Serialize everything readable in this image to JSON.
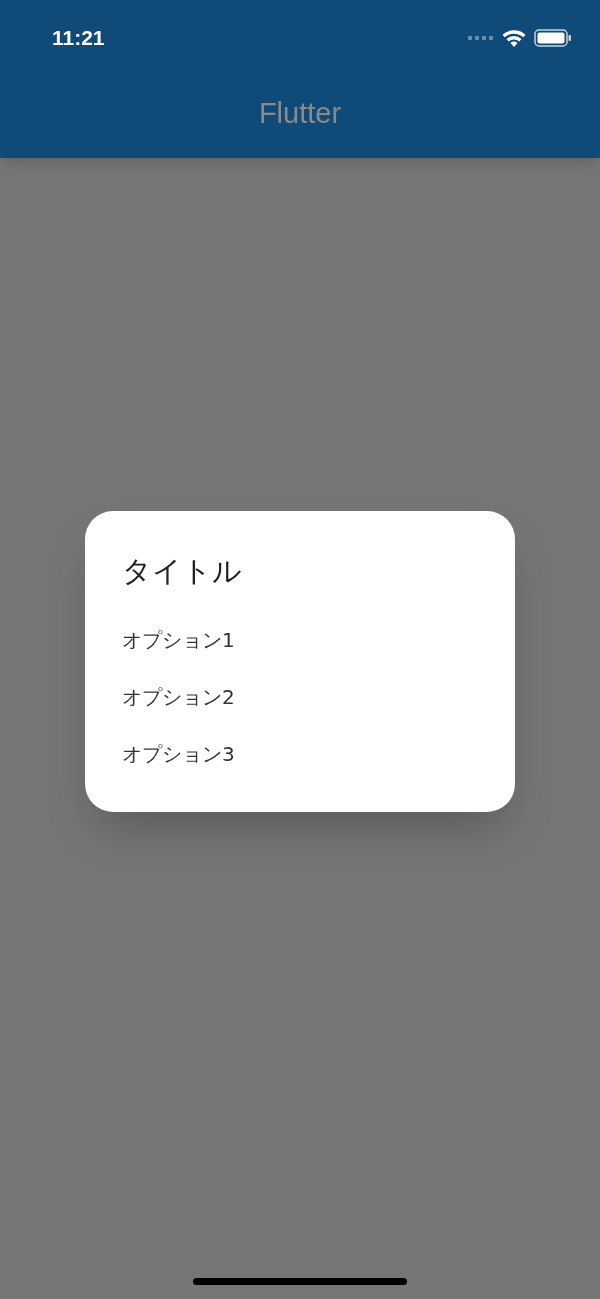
{
  "status_bar": {
    "time": "11:21"
  },
  "app_bar": {
    "title": "Flutter"
  },
  "dialog": {
    "title": "タイトル",
    "options": [
      "オプション1",
      "オプション2",
      "オプション3"
    ]
  }
}
